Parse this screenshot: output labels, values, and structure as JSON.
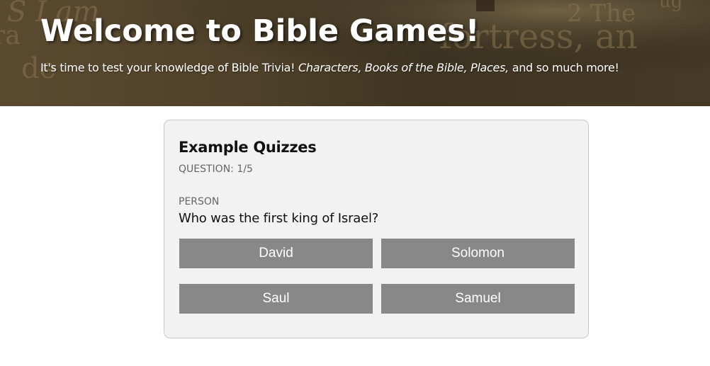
{
  "hero": {
    "title": "Welcome to Bible Games!",
    "subtitle_pre": "It's time to test your knowledge of Bible Trivia! ",
    "subtitle_em": "Characters, Books of the Bible, Places,",
    "subtitle_post": " and so much more!"
  },
  "quiz": {
    "title": "Example Quizzes",
    "counter": "QUESTION: 1/5",
    "category": "PERSON",
    "question": "Who was the first king of Israel?",
    "answers": [
      "David",
      "Solomon",
      "Saul",
      "Samuel"
    ]
  },
  "colors": {
    "hero_overlay": "#4f4129",
    "answer_button": "#888888",
    "card_background": "#f2f2f2"
  }
}
